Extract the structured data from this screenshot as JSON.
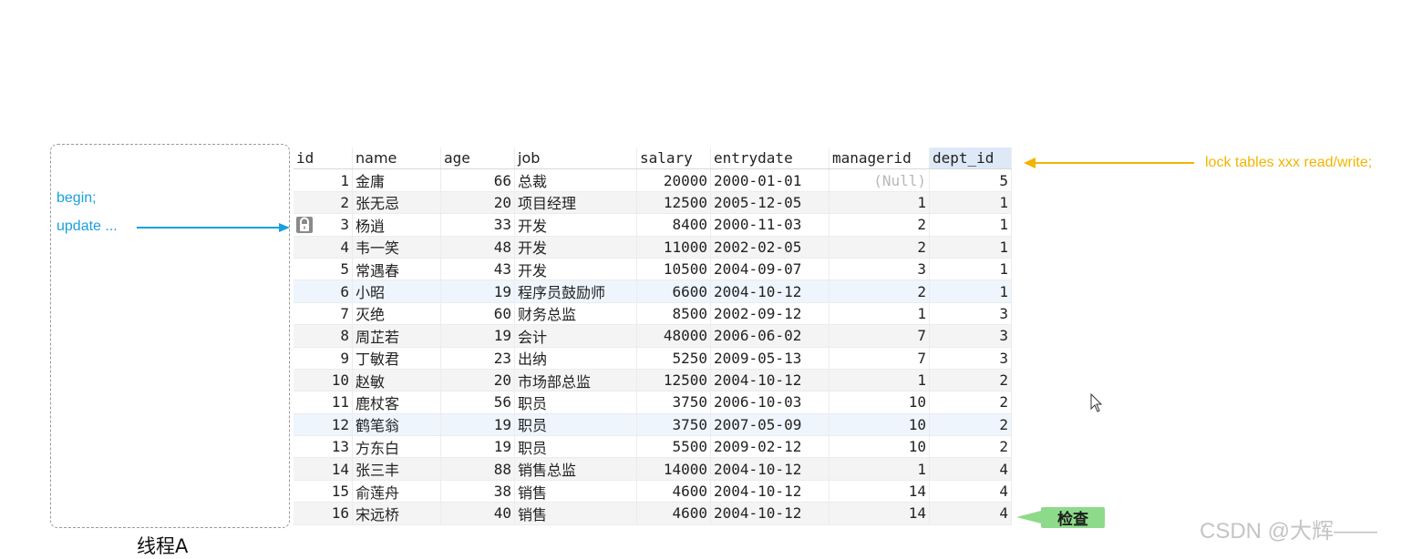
{
  "annotations": {
    "thread_label": "线程A",
    "begin": "begin;",
    "update": "update ...",
    "lock_note": "lock tables xxx read/write;",
    "check_badge": "检查",
    "watermark": "CSDN @大辉——"
  },
  "colors": {
    "annotation_blue": "#1aa0dc",
    "lock_note_yellow": "#f2b400",
    "check_badge_green": "#8ddb8a"
  },
  "icons": [
    "lock-icon",
    "arrow-right-icon",
    "arrow-left-icon",
    "mouse-cursor-icon"
  ],
  "table": {
    "columns": [
      "id",
      "name",
      "age",
      "job",
      "salary",
      "entrydate",
      "managerid",
      "dept_id"
    ],
    "rows": [
      {
        "id": "1",
        "name": "金庸",
        "age": "66",
        "job": "总裁",
        "salary": "20000",
        "entrydate": "2000-01-01",
        "managerid": "(Null)",
        "dept_id": "5"
      },
      {
        "id": "2",
        "name": "张无忌",
        "age": "20",
        "job": "项目经理",
        "salary": "12500",
        "entrydate": "2005-12-05",
        "managerid": "1",
        "dept_id": "1"
      },
      {
        "id": "3",
        "name": "杨逍",
        "age": "33",
        "job": "开发",
        "salary": "8400",
        "entrydate": "2000-11-03",
        "managerid": "2",
        "dept_id": "1",
        "locked": true
      },
      {
        "id": "4",
        "name": "韦一笑",
        "age": "48",
        "job": "开发",
        "salary": "11000",
        "entrydate": "2002-02-05",
        "managerid": "2",
        "dept_id": "1"
      },
      {
        "id": "5",
        "name": "常遇春",
        "age": "43",
        "job": "开发",
        "salary": "10500",
        "entrydate": "2004-09-07",
        "managerid": "3",
        "dept_id": "1"
      },
      {
        "id": "6",
        "name": "小昭",
        "age": "19",
        "job": "程序员鼓励师",
        "salary": "6600",
        "entrydate": "2004-10-12",
        "managerid": "2",
        "dept_id": "1"
      },
      {
        "id": "7",
        "name": "灭绝",
        "age": "60",
        "job": "财务总监",
        "salary": "8500",
        "entrydate": "2002-09-12",
        "managerid": "1",
        "dept_id": "3"
      },
      {
        "id": "8",
        "name": "周芷若",
        "age": "19",
        "job": "会计",
        "salary": "48000",
        "entrydate": "2006-06-02",
        "managerid": "7",
        "dept_id": "3"
      },
      {
        "id": "9",
        "name": "丁敏君",
        "age": "23",
        "job": "出纳",
        "salary": "5250",
        "entrydate": "2009-05-13",
        "managerid": "7",
        "dept_id": "3"
      },
      {
        "id": "10",
        "name": "赵敏",
        "age": "20",
        "job": "市场部总监",
        "salary": "12500",
        "entrydate": "2004-10-12",
        "managerid": "1",
        "dept_id": "2"
      },
      {
        "id": "11",
        "name": "鹿杖客",
        "age": "56",
        "job": "职员",
        "salary": "3750",
        "entrydate": "2006-10-03",
        "managerid": "10",
        "dept_id": "2"
      },
      {
        "id": "12",
        "name": "鹤笔翁",
        "age": "19",
        "job": "职员",
        "salary": "3750",
        "entrydate": "2007-05-09",
        "managerid": "10",
        "dept_id": "2"
      },
      {
        "id": "13",
        "name": "方东白",
        "age": "19",
        "job": "职员",
        "salary": "5500",
        "entrydate": "2009-02-12",
        "managerid": "10",
        "dept_id": "2"
      },
      {
        "id": "14",
        "name": "张三丰",
        "age": "88",
        "job": "销售总监",
        "salary": "14000",
        "entrydate": "2004-10-12",
        "managerid": "1",
        "dept_id": "4"
      },
      {
        "id": "15",
        "name": "俞莲舟",
        "age": "38",
        "job": "销售",
        "salary": "4600",
        "entrydate": "2004-10-12",
        "managerid": "14",
        "dept_id": "4"
      },
      {
        "id": "16",
        "name": "宋远桥",
        "age": "40",
        "job": "销售",
        "salary": "4600",
        "entrydate": "2004-10-12",
        "managerid": "14",
        "dept_id": "4"
      }
    ]
  }
}
